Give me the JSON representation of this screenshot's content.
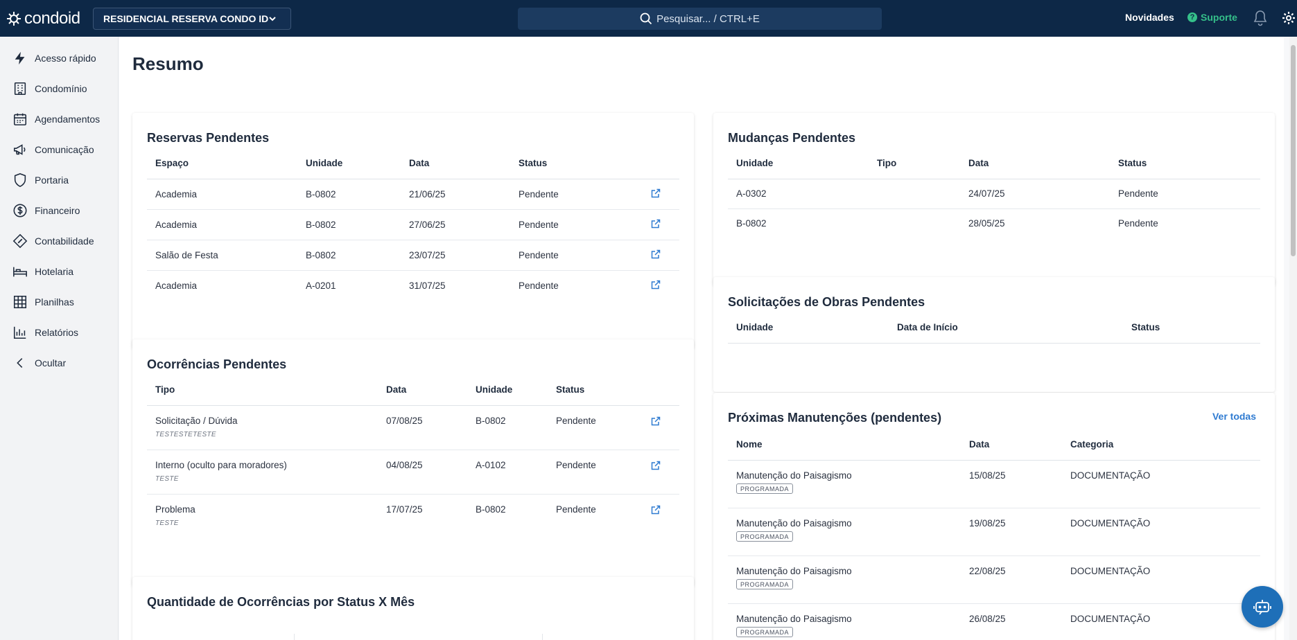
{
  "brand": {
    "name": "condoid"
  },
  "header": {
    "condo_name": "RESIDENCIAL RESERVA CONDO ID",
    "search_placeholder": "Pesquisar... / CTRL+E",
    "novidades": "Novidades",
    "suporte": "Suporte"
  },
  "sidebar": {
    "items": [
      {
        "label": "Acesso rápido",
        "icon": "bolt-icon"
      },
      {
        "label": "Condomínio",
        "icon": "building-icon"
      },
      {
        "label": "Agendamentos",
        "icon": "calendar-icon"
      },
      {
        "label": "Comunicação",
        "icon": "megaphone-icon"
      },
      {
        "label": "Portaria",
        "icon": "shield-icon"
      },
      {
        "label": "Financeiro",
        "icon": "dollar-icon"
      },
      {
        "label": "Contabilidade",
        "icon": "diamond-icon"
      },
      {
        "label": "Hotelaria",
        "icon": "bed-icon"
      },
      {
        "label": "Planilhas",
        "icon": "grid-icon"
      },
      {
        "label": "Relatórios",
        "icon": "bar-chart-icon"
      },
      {
        "label": "Ocultar",
        "icon": "chevron-left-icon"
      }
    ]
  },
  "main": {
    "title": "Resumo",
    "reservas": {
      "title": "Reservas Pendentes",
      "headers": [
        "Espaço",
        "Unidade",
        "Data",
        "Status"
      ],
      "rows": [
        {
          "espaco": "Academia",
          "unidade": "B-0802",
          "data": "21/06/25",
          "status": "Pendente"
        },
        {
          "espaco": "Academia",
          "unidade": "B-0802",
          "data": "27/06/25",
          "status": "Pendente"
        },
        {
          "espaco": "Salão de Festa",
          "unidade": "B-0802",
          "data": "23/07/25",
          "status": "Pendente"
        },
        {
          "espaco": "Academia",
          "unidade": "A-0201",
          "data": "31/07/25",
          "status": "Pendente"
        }
      ]
    },
    "ocorrencias": {
      "title": "Ocorrências Pendentes",
      "headers": [
        "Tipo",
        "Data",
        "Unidade",
        "Status"
      ],
      "rows": [
        {
          "tipo": "Solicitação / Dúvida",
          "sub": "TESTESTETESTE",
          "data": "07/08/25",
          "unidade": "B-0802",
          "status": "Pendente"
        },
        {
          "tipo": "Interno (oculto para moradores)",
          "sub": "TESTE",
          "data": "04/08/25",
          "unidade": "A-0102",
          "status": "Pendente"
        },
        {
          "tipo": "Problema",
          "sub": "TESTE",
          "data": "17/07/25",
          "unidade": "B-0802",
          "status": "Pendente"
        }
      ]
    },
    "quantidade": {
      "title": "Quantidade de Ocorrências por Status X Mês"
    },
    "mudancas": {
      "title": "Mudanças Pendentes",
      "headers": [
        "Unidade",
        "Tipo",
        "Data",
        "Status"
      ],
      "rows": [
        {
          "unidade": "A-0302",
          "tipo": "",
          "data": "24/07/25",
          "status": "Pendente"
        },
        {
          "unidade": "B-0802",
          "tipo": "",
          "data": "28/05/25",
          "status": "Pendente"
        }
      ]
    },
    "obras": {
      "title": "Solicitações de Obras Pendentes",
      "headers": [
        "Unidade",
        "Data de Início",
        "Status"
      ]
    },
    "manutencoes": {
      "title": "Próximas Manutenções (pendentes)",
      "ver_todas": "Ver todas",
      "headers": [
        "Nome",
        "Data",
        "Categoria"
      ],
      "rows": [
        {
          "nome": "Manutenção do Paisagismo",
          "badge": "PROGRAMADA",
          "data": "15/08/25",
          "categoria": "DOCUMENTAÇÃO"
        },
        {
          "nome": "Manutenção do Paisagismo",
          "badge": "PROGRAMADA",
          "data": "19/08/25",
          "categoria": "DOCUMENTAÇÃO"
        },
        {
          "nome": "Manutenção do Paisagismo",
          "badge": "PROGRAMADA",
          "data": "22/08/25",
          "categoria": "DOCUMENTAÇÃO"
        },
        {
          "nome": "Manutenção do Paisagismo",
          "badge": "PROGRAMADA",
          "data": "26/08/25",
          "categoria": "DOCUMENTAÇÃO"
        }
      ]
    }
  },
  "colors": {
    "header_bg": "#0d2847",
    "accent": "#2f7bd1",
    "support": "#35c08a"
  }
}
